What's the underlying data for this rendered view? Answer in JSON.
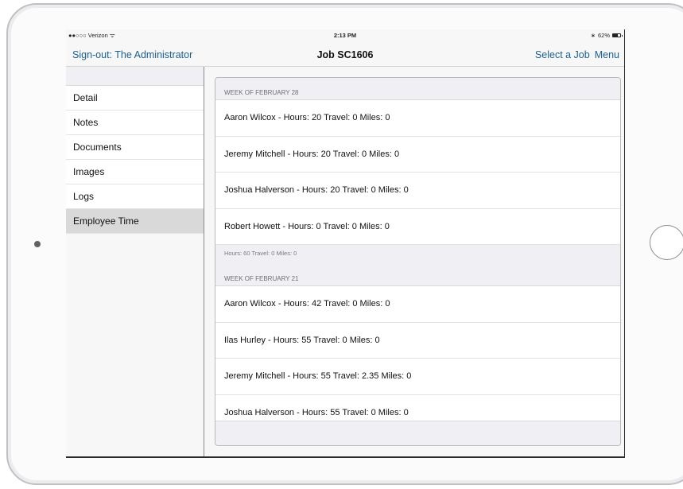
{
  "status_bar": {
    "carrier": "●●○○○ Verizon ᯤ",
    "time": "2:13 PM",
    "bluetooth": "∗",
    "battery_percent": "62%"
  },
  "nav": {
    "left_label": "Sign-out: The Administrator",
    "title": "Job SC1606",
    "select_job_label": "Select a Job",
    "menu_label": "Menu"
  },
  "sidebar": {
    "items": [
      {
        "label": "Detail"
      },
      {
        "label": "Notes"
      },
      {
        "label": "Documents"
      },
      {
        "label": "Images"
      },
      {
        "label": "Logs"
      },
      {
        "label": "Employee Time",
        "selected": true
      }
    ]
  },
  "sections": [
    {
      "header": "WEEK OF FEBRUARY 28",
      "rows": [
        "Aaron Wilcox - Hours: 20 Travel: 0 Miles: 0",
        "Jeremy Mitchell - Hours: 20 Travel: 0 Miles: 0",
        "Joshua Halverson - Hours: 20 Travel: 0 Miles: 0",
        "Robert Howett - Hours: 0 Travel: 0 Miles: 0"
      ],
      "footer": "Hours: 60 Travel: 0 Miles: 0"
    },
    {
      "header": "WEEK OF FEBRUARY 21",
      "rows": [
        "Aaron Wilcox - Hours: 42 Travel: 0 Miles: 0",
        "Ilas Hurley - Hours: 55 Travel: 0 Miles: 0",
        "Jeremy Mitchell - Hours: 55 Travel: 2.35 Miles: 0",
        "Joshua Halverson - Hours: 55 Travel: 0 Miles: 0"
      ]
    }
  ],
  "colors": {
    "accent": "#1a5f8f",
    "selected_row": "#d9d9d9",
    "grouped_background": "#efeff4"
  }
}
